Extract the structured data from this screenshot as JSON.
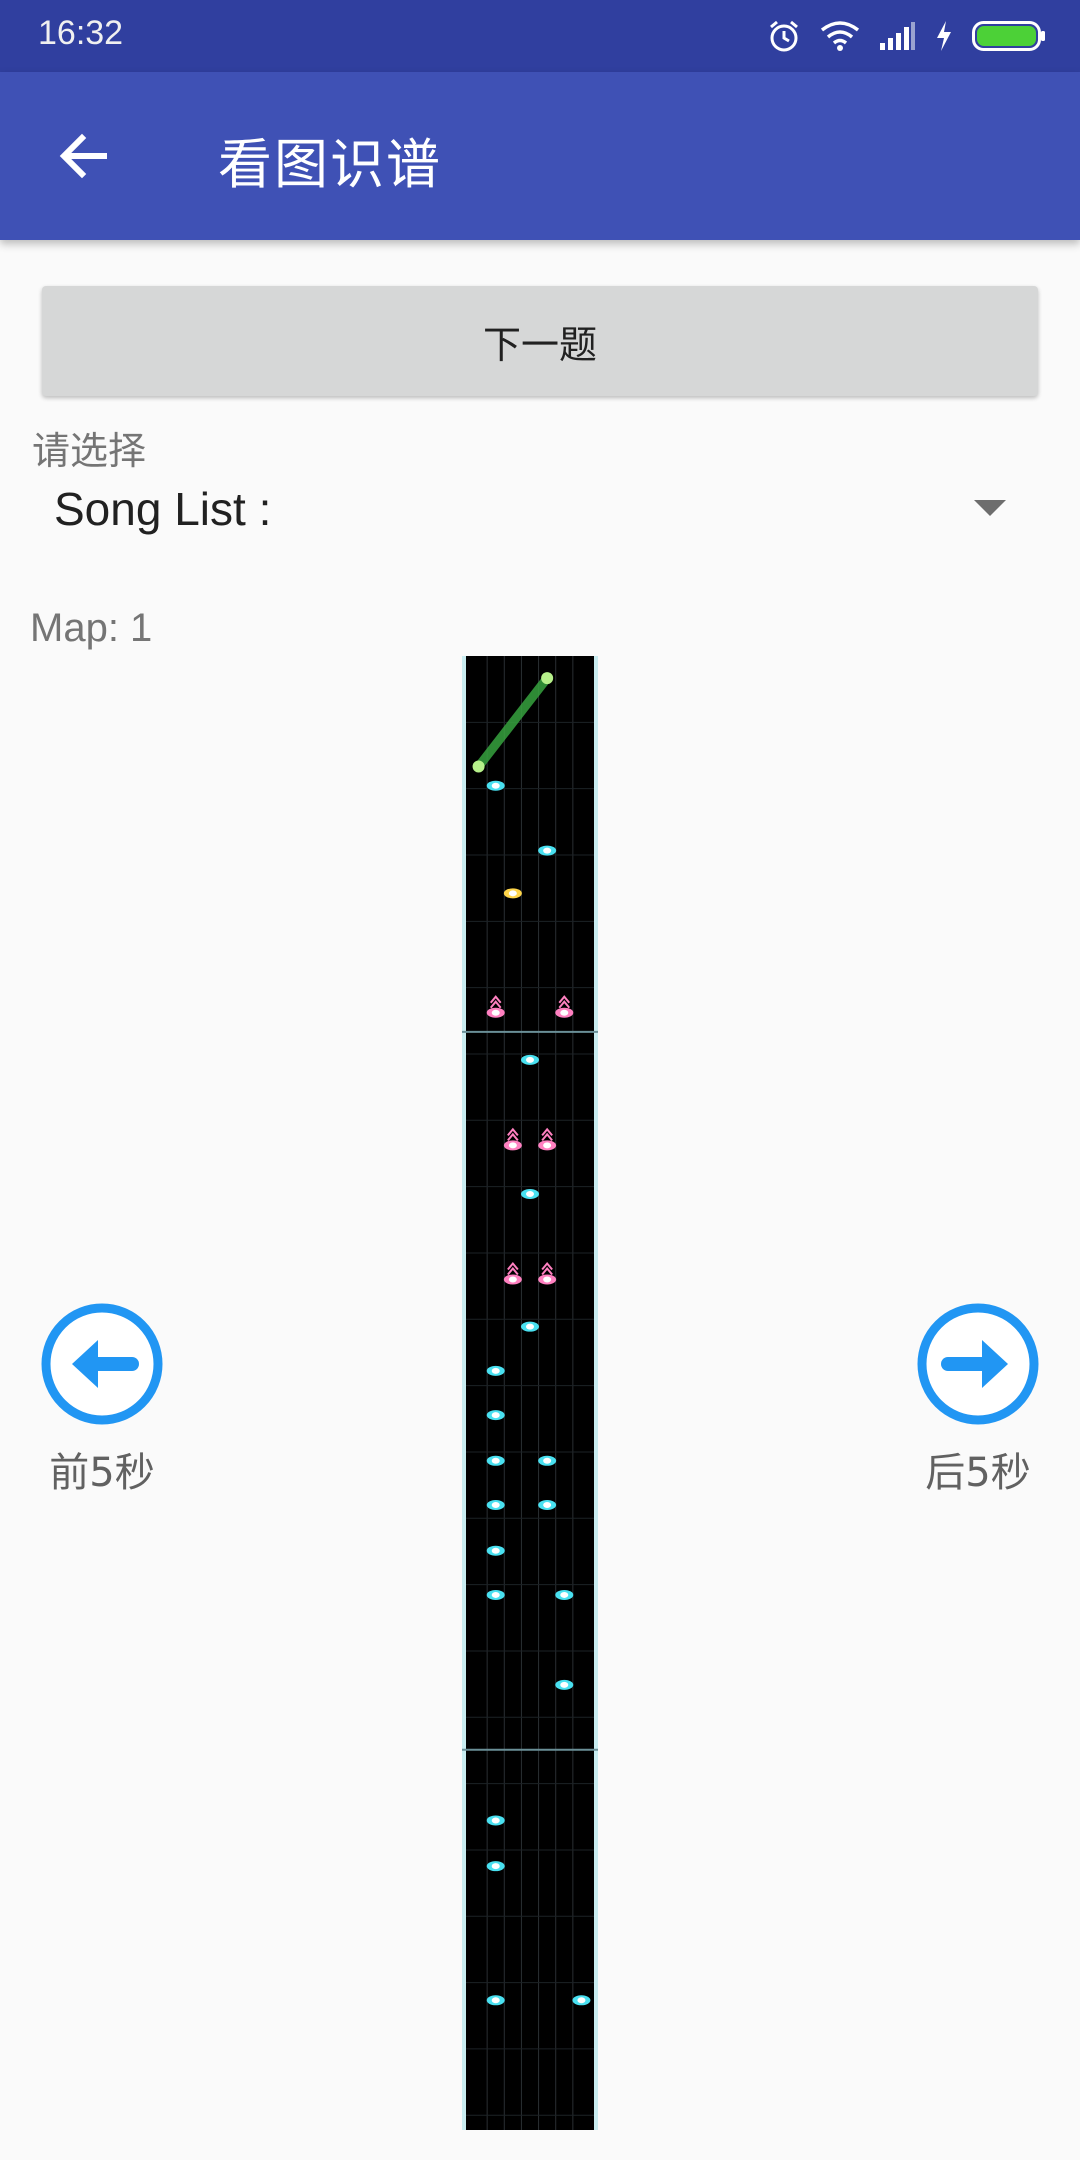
{
  "status_bar": {
    "time": "16:32",
    "icons": [
      "alarm-icon",
      "wifi-icon",
      "signal-icon",
      "charging-icon",
      "battery-icon"
    ],
    "battery_color": "#4cd137"
  },
  "app_bar": {
    "title": "看图识谱",
    "back_icon": "arrow-back-icon",
    "color": "#3f51b5"
  },
  "next_question_label": "下一题",
  "select": {
    "label": "请选择",
    "value": "Song List :"
  },
  "map": {
    "label": "Map: 1"
  },
  "nav": {
    "prev_label": "前5秒",
    "next_label": "后5秒",
    "prev_icon": "arrow-left-circle-icon",
    "next_icon": "arrow-right-circle-icon",
    "accent": "#2196f3"
  },
  "chart_data": {
    "type": "scatter",
    "lanes": 5,
    "time_window": [
      0,
      100
    ],
    "notes": [
      {
        "lane": 2,
        "t": 8.8,
        "kind": "tap"
      },
      {
        "lane": 5,
        "t": 13.2,
        "kind": "tap"
      },
      {
        "lane": 3,
        "t": 16.1,
        "kind": "gold"
      },
      {
        "lane": 2,
        "t": 24.2,
        "kind": "flick"
      },
      {
        "lane": 6,
        "t": 24.2,
        "kind": "flick"
      },
      {
        "lane": 4,
        "t": 27.4,
        "kind": "tap"
      },
      {
        "lane": 3,
        "t": 33.2,
        "kind": "flick"
      },
      {
        "lane": 5,
        "t": 33.2,
        "kind": "flick"
      },
      {
        "lane": 4,
        "t": 36.5,
        "kind": "tap"
      },
      {
        "lane": 3,
        "t": 42.3,
        "kind": "flick"
      },
      {
        "lane": 5,
        "t": 42.3,
        "kind": "flick"
      },
      {
        "lane": 4,
        "t": 45.5,
        "kind": "tap"
      },
      {
        "lane": 2,
        "t": 48.5,
        "kind": "tap"
      },
      {
        "lane": 2,
        "t": 51.5,
        "kind": "tap"
      },
      {
        "lane": 2,
        "t": 54.6,
        "kind": "tap"
      },
      {
        "lane": 5,
        "t": 54.6,
        "kind": "tap"
      },
      {
        "lane": 2,
        "t": 57.6,
        "kind": "tap"
      },
      {
        "lane": 5,
        "t": 57.6,
        "kind": "tap"
      },
      {
        "lane": 2,
        "t": 60.7,
        "kind": "tap"
      },
      {
        "lane": 2,
        "t": 63.7,
        "kind": "tap"
      },
      {
        "lane": 6,
        "t": 63.7,
        "kind": "tap"
      },
      {
        "lane": 6,
        "t": 69.8,
        "kind": "tap"
      },
      {
        "lane": 2,
        "t": 79.0,
        "kind": "tap"
      },
      {
        "lane": 2,
        "t": 82.1,
        "kind": "tap"
      },
      {
        "lane": 2,
        "t": 91.2,
        "kind": "tap"
      },
      {
        "lane": 7,
        "t": 91.2,
        "kind": "tap"
      }
    ],
    "slides": [
      {
        "lane_start": 1,
        "t_start": 7.5,
        "lane_end": 5,
        "t_end": 1.5
      }
    ],
    "measure_lines": [
      25.5,
      74.2
    ],
    "colors": {
      "tap": "#49e0f0",
      "flick": "#ff80c0",
      "gold": "#ffd54a",
      "slide": "#37a33f",
      "background": "#000000",
      "border": "#9fe0e8"
    }
  }
}
